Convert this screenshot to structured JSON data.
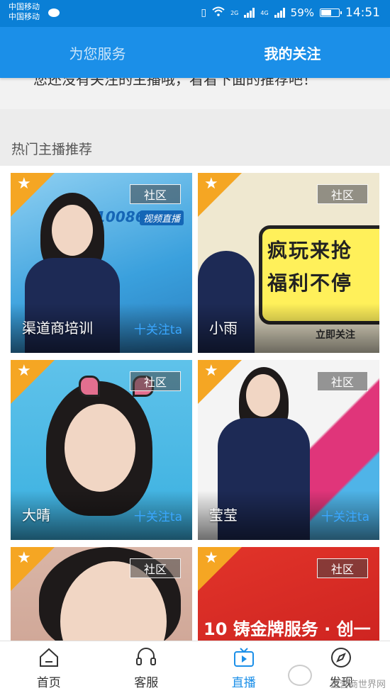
{
  "status": {
    "carrier_line1": "中国移动",
    "carrier_line2": "中国移动",
    "net1": "2G",
    "net2": "4G",
    "battery": "59%",
    "battery_level": 0.59,
    "time": "14:51"
  },
  "tabs": [
    {
      "label": "为您服务",
      "active": false
    },
    {
      "label": "我的关注",
      "active": true
    }
  ],
  "notice": "您还没有关注的主播哦，看看下面的推荐吧！",
  "section_title": "热门主播推荐",
  "cards": [
    {
      "name": "渠道商培训",
      "tag": "社区",
      "follow": "十关注ta",
      "logo_text": "10086",
      "live_text": "视频直播"
    },
    {
      "name": "小雨",
      "tag": "社区",
      "follow": "",
      "promo_line1": "疯玩来抢",
      "promo_line2": "福利不停",
      "promo_small": "立即关注"
    },
    {
      "name": "大晴",
      "tag": "社区",
      "follow": "十关注ta"
    },
    {
      "name": "莹莹",
      "tag": "社区",
      "follow": "十关注ta"
    },
    {
      "name": "",
      "tag": "社区",
      "follow": ""
    },
    {
      "name": "",
      "tag": "社区",
      "follow": "",
      "promo_line1": "10 铸金牌服务 · 创一"
    }
  ],
  "nav": [
    {
      "label": "首页",
      "icon": "home-icon",
      "active": false
    },
    {
      "label": "客服",
      "icon": "headset-icon",
      "active": false
    },
    {
      "label": "直播",
      "icon": "tv-play-icon",
      "active": true
    },
    {
      "label": "发现",
      "icon": "compass-icon",
      "active": false
    }
  ],
  "watermark": "运营商世界网",
  "colors": {
    "primary": "#1b8fe8",
    "status_bar": "#0a7fd6",
    "corner": "#f5a623",
    "follow": "#3aa7ff"
  }
}
